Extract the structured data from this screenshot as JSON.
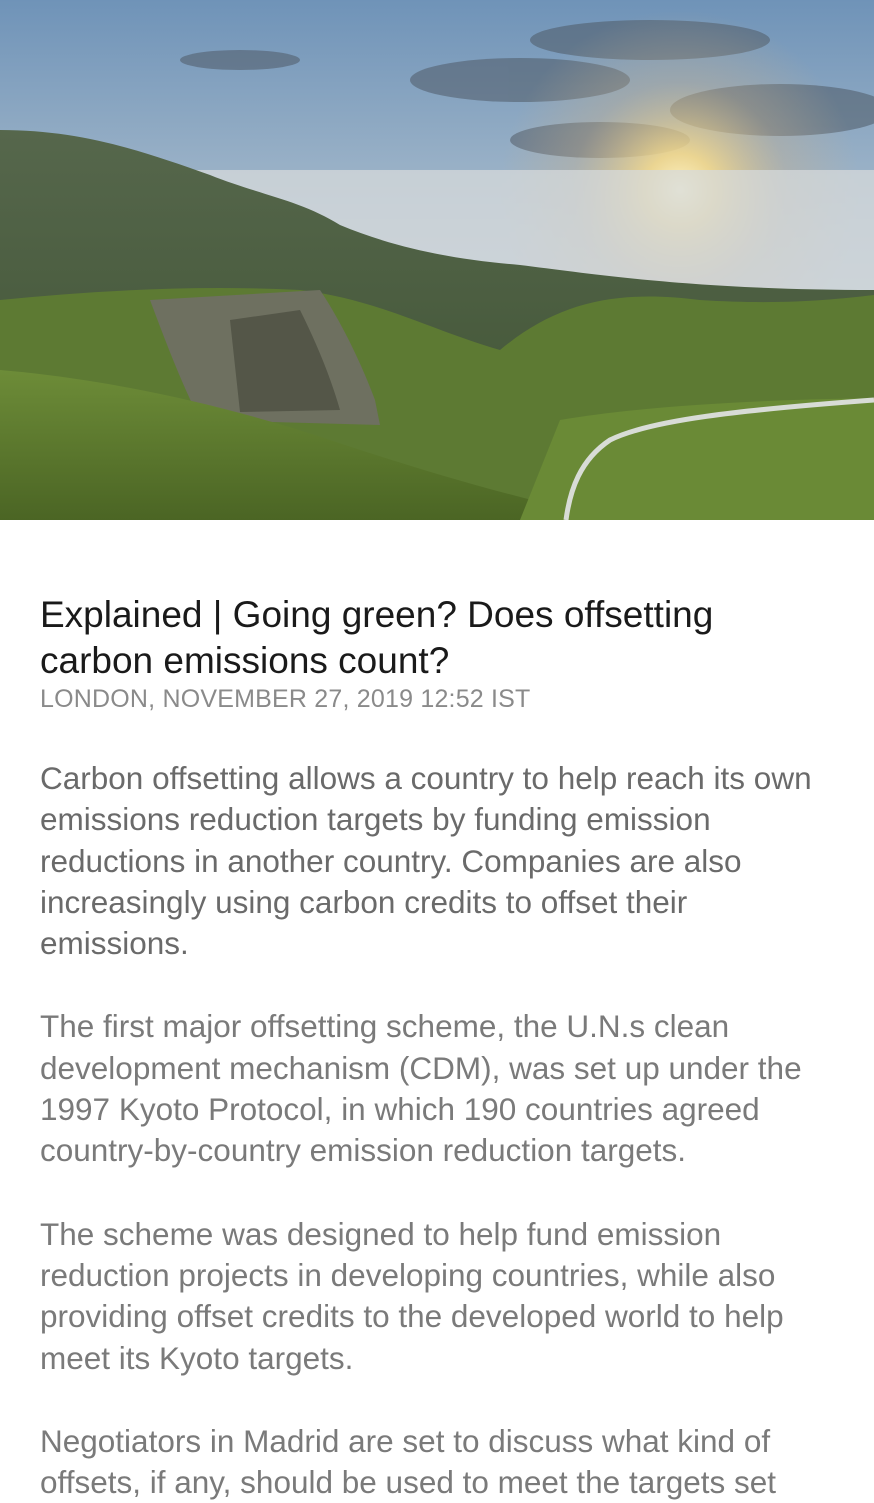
{
  "hero_image": {
    "icon": "landscape-photo",
    "colors": {
      "sky_top": "#6f93b8",
      "sky_bottom": "#c9d6e0",
      "sun": "#ffe9a8",
      "hill": "#4f6a32",
      "grass": "#7a9a3c",
      "road": "#d8dcd6"
    }
  },
  "article": {
    "headline": "Explained | Going green? Does offsetting carbon emissions count?",
    "dateline": "LONDON, NOVEMBER 27, 2019 12:52 IST",
    "paragraphs": [
      "Carbon offsetting allows a country to help reach its own emissions reduction targets by funding emission reductions in another country. Companies are also increasingly using carbon credits to offset their emissions.",
      "The first major offsetting scheme, the U.N.s clean development mechanism (CDM), was set up under the 1997 Kyoto Protocol, in which 190 countries agreed country-by-country emission reduction targets.",
      "The scheme was designed to help fund emission reduction projects in developing countries, while also providing offset credits to the developed world to help meet its Kyoto targets.",
      "Negotiators in Madrid are set to discuss what kind of offsets, if any, should be used to meet the targets set"
    ]
  }
}
